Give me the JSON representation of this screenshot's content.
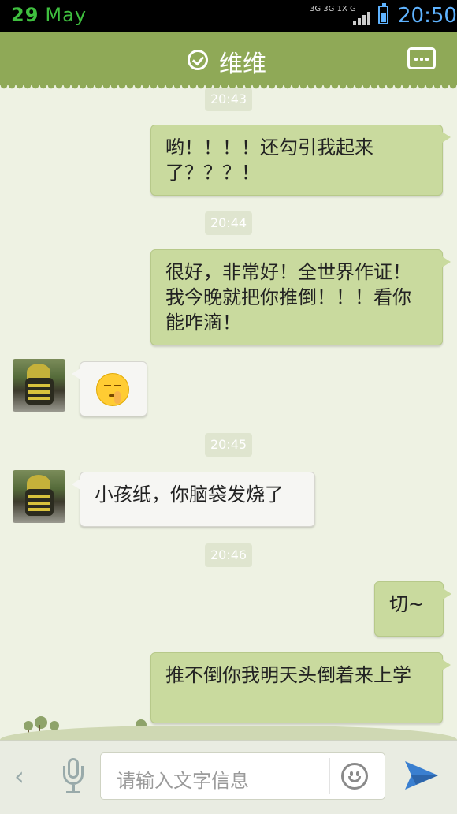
{
  "status_bar": {
    "date_day": "29",
    "date_month": "May",
    "network_top": "3G 3G 1X G",
    "time": "20:50"
  },
  "header": {
    "title": "维维",
    "check_icon": "check-circle-icon",
    "menu_icon": "more-dots-icon"
  },
  "chat": {
    "timestamps": [
      "20:43",
      "20:44",
      "20:45",
      "20:46"
    ],
    "messages": [
      {
        "from": "me",
        "text": "哟！！！！还勾引我起来了？？？！"
      },
      {
        "from": "me",
        "text": "很好，非常好！全世界作证！我今晚就把你推倒！！！看你能咋滴！"
      },
      {
        "from": "contact",
        "type": "emoji",
        "emoji": "shush-face-emoji"
      },
      {
        "from": "contact",
        "text": "小孩纸，你脑袋发烧了"
      },
      {
        "from": "me",
        "text": "切~"
      },
      {
        "from": "me",
        "text": "推不倒你我明天头倒着来上学"
      }
    ]
  },
  "input_bar": {
    "placeholder": "请输入文字信息",
    "back_icon": "chevron-left-icon",
    "mic_icon": "microphone-icon",
    "smiley_icon": "smiley-icon",
    "send_icon": "send-paper-plane-icon"
  },
  "colors": {
    "header_bg": "#8fa957",
    "outgoing_bubble": "#c9da9e",
    "incoming_bubble": "#f6f6f3",
    "status_time": "#5fb3ff",
    "status_date": "#3fbf3f"
  }
}
